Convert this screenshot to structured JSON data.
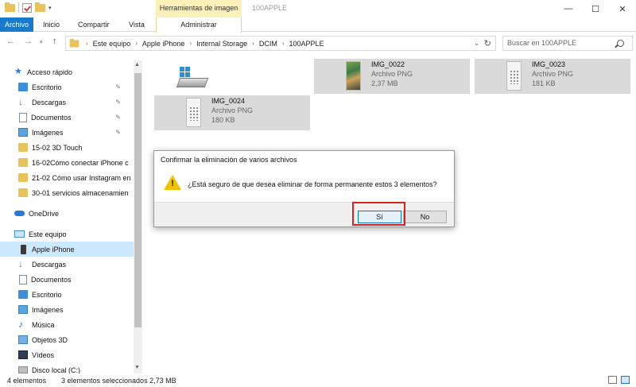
{
  "titlebar": {
    "window_title": "100APPLE",
    "contextual_group": "Herramientas de imagen",
    "controls": {
      "minimize": "—",
      "maximize": "☐",
      "close": "✕"
    }
  },
  "ribbon": {
    "tabs": [
      "Archivo",
      "Inicio",
      "Compartir",
      "Vista",
      "Administrar"
    ]
  },
  "address": {
    "breadcrumb": [
      "Este equipo",
      "Apple iPhone",
      "Internal Storage",
      "DCIM",
      "100APPLE"
    ],
    "search_placeholder": "Buscar en 100APPLE"
  },
  "sidebar": {
    "items": [
      {
        "label": "Acceso rápido",
        "icon": "star-icon"
      },
      {
        "label": "Escritorio",
        "icon": "desktop-folder-icon",
        "pinned": true
      },
      {
        "label": "Descargas",
        "icon": "download-icon",
        "pinned": true
      },
      {
        "label": "Documentos",
        "icon": "document-icon",
        "pinned": true
      },
      {
        "label": "Imágenes",
        "icon": "pictures-icon",
        "pinned": true
      },
      {
        "label": "15-02 3D Touch",
        "icon": "folder-icon"
      },
      {
        "label": "16-02Cómo conectar iPhone c",
        "icon": "folder-icon"
      },
      {
        "label": "21-02 Cómo usar Instagram en",
        "icon": "folder-icon"
      },
      {
        "label": "30-01 servicios almacenamien",
        "icon": "folder-icon"
      },
      {
        "label": "OneDrive",
        "icon": "cloud-icon"
      },
      {
        "label": "Este equipo",
        "icon": "computer-icon"
      },
      {
        "label": "Apple iPhone",
        "icon": "phone-icon",
        "selected": true
      },
      {
        "label": "Descargas",
        "icon": "download-icon"
      },
      {
        "label": "Documentos",
        "icon": "document-icon"
      },
      {
        "label": "Escritorio",
        "icon": "desktop-folder-icon"
      },
      {
        "label": "Imágenes",
        "icon": "pictures-icon"
      },
      {
        "label": "Música",
        "icon": "music-icon"
      },
      {
        "label": "Objetos 3D",
        "icon": "3d-objects-icon"
      },
      {
        "label": "Vídeos",
        "icon": "video-icon"
      },
      {
        "label": "Disco local (C:)",
        "icon": "disk-icon"
      }
    ],
    "pin_glyph": "📌"
  },
  "files": [
    {
      "name": "IMG_0022",
      "type": "Archivo PNG",
      "size": "2,37 MB",
      "thumb": "colorful-screenshot"
    },
    {
      "name": "IMG_0023",
      "type": "Archivo PNG",
      "size": "181 KB",
      "thumb": "keypad-screenshot"
    },
    {
      "name": "IMG_0024",
      "type": "Archivo PNG",
      "size": "180 KB",
      "thumb": "keypad-screenshot"
    }
  ],
  "dialog": {
    "title": "Confirmar la eliminación de varios archivos",
    "message": "¿Está seguro de que desea eliminar de forma permanente estos 3 elementos?",
    "icon": "warning-icon",
    "yes_label": "Sí",
    "no_label": "No",
    "highlight_color": "#d9231f"
  },
  "statusbar": {
    "item_count": "4 elementos",
    "selection": "3 elementos seleccionados  2,73 MB"
  },
  "colors": {
    "accent": "#1979ca",
    "contextual": "#fbf1b8",
    "selection": "#cce8ff",
    "warning": "#f2c200"
  }
}
